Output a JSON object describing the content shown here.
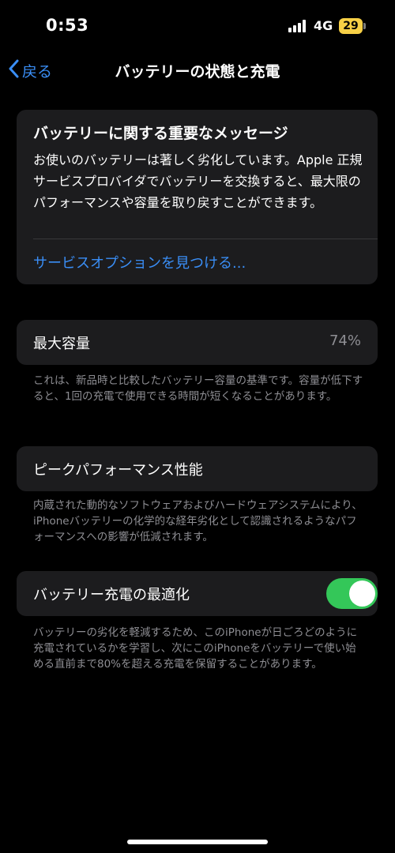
{
  "status_bar": {
    "time": "0:53",
    "network": "4G",
    "battery_level": "29",
    "battery_color": "#f7d046"
  },
  "nav": {
    "back_label": "戻る",
    "back_icon": "chevron-left-icon",
    "title": "バッテリーの状態と充電"
  },
  "message_card": {
    "title": "バッテリーに関する重要なメッセージ",
    "body": "お使いのバッテリーは著しく劣化しています。Apple 正規サービスプロバイダでバッテリーを交換すると、最大限のパフォーマンスや容量を取り戻すことができます。",
    "link": "サービスオプションを見つける..."
  },
  "max_capacity": {
    "label": "最大容量",
    "value": "74%",
    "footnote": "これは、新品時と比較したバッテリー容量の基準です。容量が低下すると、1回の充電で使用できる時間が短くなることがあります。"
  },
  "peak_performance": {
    "label": "ピークパフォーマンス性能",
    "footnote": "内蔵された動的なソフトウェアおよびハードウェアシステムにより、iPhoneバッテリーの化学的な経年劣化として認識されるようなパフォーマンスへの影響が低減されます。"
  },
  "optimized_charging": {
    "label": "バッテリー充電の最適化",
    "enabled": true,
    "toggle_color": "#34c759",
    "footnote": "バッテリーの劣化を軽減するため、このiPhoneが日ごろどのように充電されているかを学習し、次にこのiPhoneをバッテリーで使い始める直前まで80%を超える充電を保留することがあります。"
  },
  "colors": {
    "background": "#000000",
    "card": "#1c1c1e",
    "accent": "#3a8ef6",
    "secondary_text": "#8e8e93"
  }
}
